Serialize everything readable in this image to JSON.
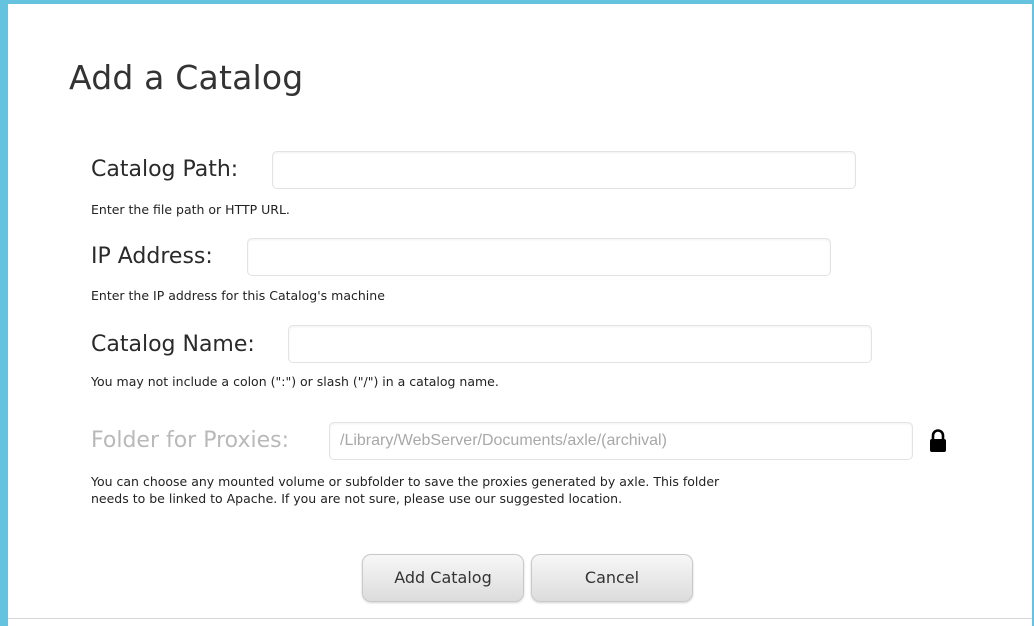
{
  "dialog": {
    "title": "Add a Catalog"
  },
  "fields": {
    "catalog_path": {
      "label": "Catalog Path:",
      "value": "",
      "help": "Enter the file path or HTTP URL."
    },
    "ip_address": {
      "label": "IP Address:",
      "value": "",
      "help": "Enter the IP address for this Catalog's machine"
    },
    "catalog_name": {
      "label": "Catalog Name:",
      "value": "",
      "help": "You may not include a colon (\":\") or slash (\"/\") in a catalog name."
    },
    "proxy_folder": {
      "label": "Folder for Proxies:",
      "value": "/Library/WebServer/Documents/axle/(archival)",
      "help_line1": "You can choose any mounted volume or subfolder to save the proxies generated by axle. This folder",
      "help_line2": "needs to be linked to Apache. If you are not sure, please use our suggested location.",
      "locked": true,
      "lock_icon": "lock-icon"
    }
  },
  "buttons": {
    "add_label": "Add Catalog",
    "cancel_label": "Cancel"
  },
  "colors": {
    "frame_accent": "#66c3df",
    "disabled_text": "#b9b9b9"
  }
}
